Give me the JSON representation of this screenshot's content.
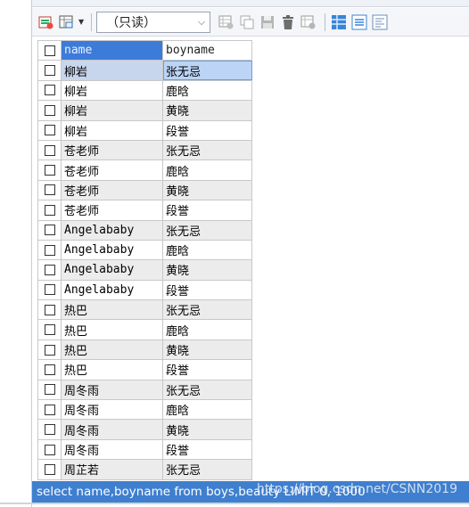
{
  "toolbar": {
    "mode_select": {
      "value": "（只读）"
    }
  },
  "table": {
    "columns": [
      "name",
      "boyname"
    ],
    "rows": [
      [
        "柳岩",
        "张无忌"
      ],
      [
        "柳岩",
        "鹿晗"
      ],
      [
        "柳岩",
        "黄晓"
      ],
      [
        "柳岩",
        "段誉"
      ],
      [
        "苍老师",
        "张无忌"
      ],
      [
        "苍老师",
        "鹿晗"
      ],
      [
        "苍老师",
        "黄晓"
      ],
      [
        "苍老师",
        "段誉"
      ],
      [
        "Angelababy",
        "张无忌"
      ],
      [
        "Angelababy",
        "鹿晗"
      ],
      [
        "Angelababy",
        "黄晓"
      ],
      [
        "Angelababy",
        "段誉"
      ],
      [
        "热巴",
        "张无忌"
      ],
      [
        "热巴",
        "鹿晗"
      ],
      [
        "热巴",
        "黄晓"
      ],
      [
        "热巴",
        "段誉"
      ],
      [
        "周冬雨",
        "张无忌"
      ],
      [
        "周冬雨",
        "鹿晗"
      ],
      [
        "周冬雨",
        "黄晓"
      ],
      [
        "周冬雨",
        "段誉"
      ],
      [
        "周芷若",
        "张无忌"
      ]
    ]
  },
  "statusbar": {
    "query": "select name,boyname from boys,beauty LIMIT 0, 1000"
  },
  "watermark": {
    "text": "https://blog.csdn.net/CSNN2019"
  },
  "colors": {
    "status_blue": "#3f7fcf",
    "header_highlight": "#3d7bd9",
    "selected_cell": "#bcd4f5"
  }
}
